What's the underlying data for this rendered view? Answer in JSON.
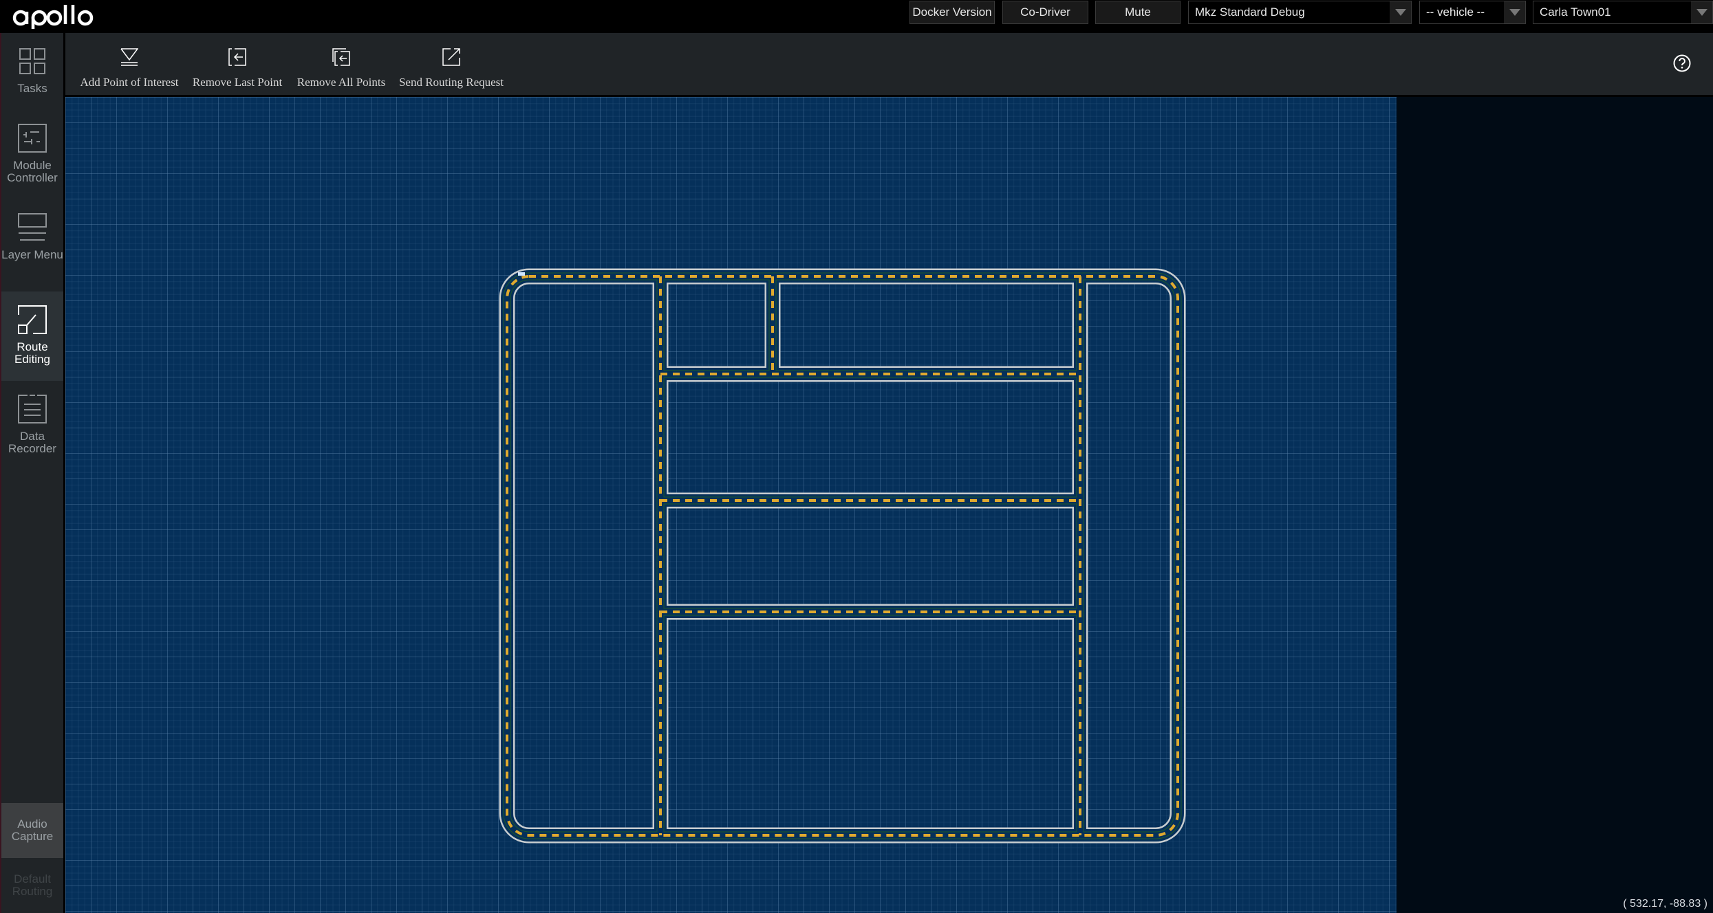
{
  "header": {
    "logo": "apollo",
    "buttons": [
      {
        "label": "Docker Version"
      },
      {
        "label": "Co-Driver"
      },
      {
        "label": "Mute"
      }
    ],
    "selects": [
      {
        "name": "mode",
        "value": "Mkz Standard Debug"
      },
      {
        "name": "vehicle",
        "value": "-- vehicle --"
      },
      {
        "name": "map",
        "value": "Carla Town01"
      }
    ]
  },
  "sidebar": {
    "items": [
      {
        "label": "Tasks",
        "icon": "tasks-icon"
      },
      {
        "label": "Module Controller",
        "icon": "module-controller-icon"
      },
      {
        "label": "Layer Menu",
        "icon": "layer-menu-icon"
      },
      {
        "label": "Route Editing",
        "icon": "route-editing-icon",
        "active": true
      },
      {
        "label": "Data Recorder",
        "icon": "data-recorder-icon"
      }
    ],
    "bottom": [
      {
        "label": "Audio Capture"
      },
      {
        "label": "Default Routing",
        "disabled": true
      }
    ]
  },
  "toolbar": {
    "buttons": [
      {
        "label": "Add Point of Interest",
        "icon": "add-point-icon"
      },
      {
        "label": "Remove Last Point",
        "icon": "remove-last-point-icon"
      },
      {
        "label": "Remove All Points",
        "icon": "remove-all-points-icon"
      },
      {
        "label": "Send Routing Request",
        "icon": "send-routing-icon"
      }
    ],
    "help_icon": "help-icon"
  },
  "map": {
    "name": "Carla Town01",
    "cursor_coordinate": "( 532.17, -88.83 )",
    "colors": {
      "background": "#05305a",
      "road_edge": "#c8cdd0",
      "lane_line": "#1f5a2a",
      "center_line": "#e0aa2e"
    }
  }
}
